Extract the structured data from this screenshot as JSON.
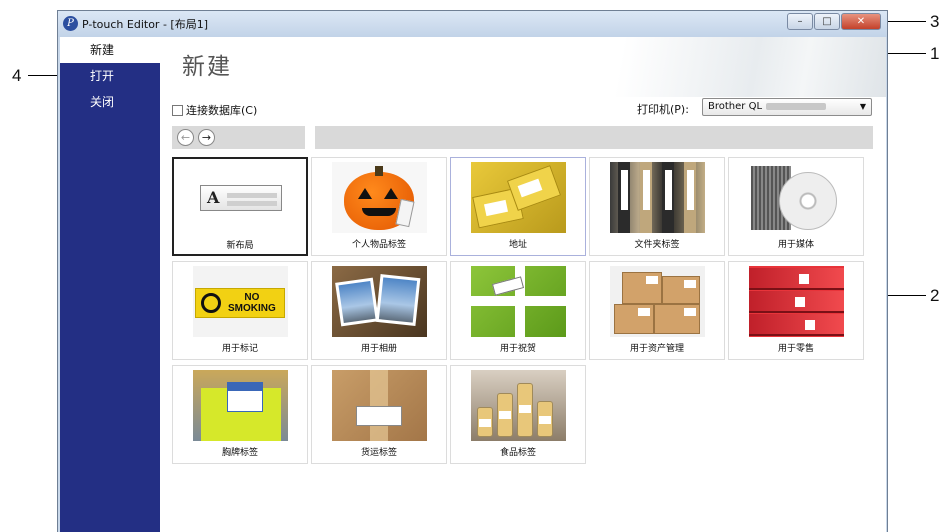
{
  "window": {
    "title": "P-touch Editor - [布局1]",
    "app_icon_glyph": "P",
    "controls": {
      "minimize": "–",
      "maximize": "□",
      "close": "✕"
    }
  },
  "sidebar": {
    "items": [
      {
        "label": "新建",
        "active": true
      },
      {
        "label": "打开",
        "active": false
      },
      {
        "label": "关闭",
        "active": false
      }
    ]
  },
  "main": {
    "title": "新建",
    "connect_db_label": "连接数据库(C)",
    "connect_db_checked": false,
    "printer_label": "打印机(P):",
    "printer_value": "Brother QL",
    "nav": {
      "back_icon": "←",
      "forward_icon": "→"
    },
    "templates": [
      {
        "label": "新布局",
        "icon": "new-layout-icon"
      },
      {
        "label": "个人物品标签",
        "icon": "pumpkin-photo"
      },
      {
        "label": "地址",
        "icon": "address-photo"
      },
      {
        "label": "文件夹标签",
        "icon": "folder-photo"
      },
      {
        "label": "用于媒体",
        "icon": "media-photo"
      },
      {
        "label": "用于标记",
        "icon": "sign-photo",
        "sign_text": "NO\nSMOKING"
      },
      {
        "label": "用于相册",
        "icon": "album-photo"
      },
      {
        "label": "用于祝贺",
        "icon": "gift-photo"
      },
      {
        "label": "用于资产管理",
        "icon": "asset-photo"
      },
      {
        "label": "用于零售",
        "icon": "retail-photo"
      },
      {
        "label": "胸牌标签",
        "icon": "badge-photo"
      },
      {
        "label": "货运标签",
        "icon": "shipping-photo"
      },
      {
        "label": "食品标签",
        "icon": "food-photo"
      }
    ]
  },
  "callouts": [
    "1",
    "2",
    "3",
    "4"
  ]
}
